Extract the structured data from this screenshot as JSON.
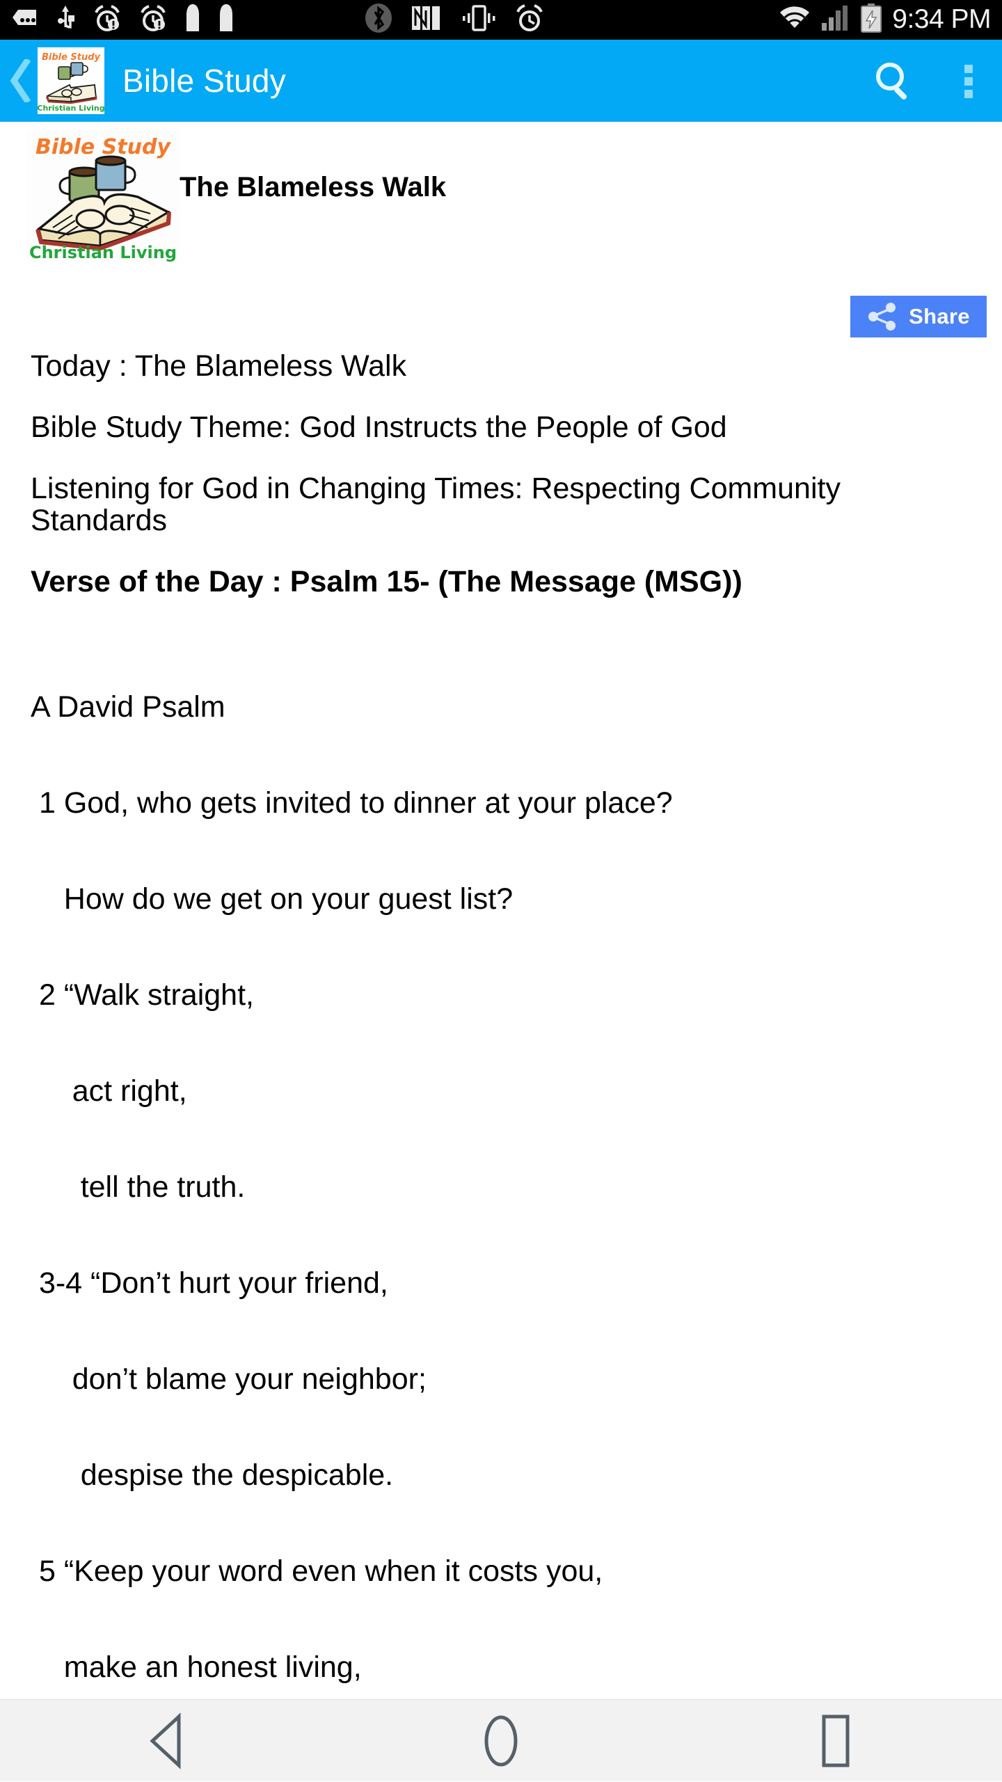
{
  "statusbar": {
    "time": "9:34 PM",
    "icons_left": [
      "sms-icon",
      "usb-icon",
      "alarm-alert-icon",
      "alarm-alert-icon",
      "silent-icon",
      "silent-icon"
    ],
    "icons_mid": [
      "bluetooth-icon",
      "nfc-icon",
      "vibrate-icon",
      "alarm-icon"
    ],
    "icons_right": [
      "wifi-icon",
      "signal-icon",
      "battery-charging-icon"
    ]
  },
  "appbar": {
    "title": "Bible Study",
    "back_label": "Back",
    "search_label": "Search",
    "menu_label": "More options",
    "color": "#03A9F4",
    "logo": {
      "top_text": "Bible Study",
      "bottom_text": "Christian Living"
    }
  },
  "hero": {
    "title": "The Blameless Walk",
    "logo": {
      "top_text": "Bible Study",
      "bottom_text": "Christian Living"
    }
  },
  "share": {
    "label": "Share",
    "color": "#4C82F7"
  },
  "article": {
    "paragraphs": [
      {
        "text": "Today : The Blameless Walk",
        "bold": false
      },
      {
        "text": "Bible Study Theme: God Instructs the People of God",
        "bold": false
      },
      {
        "text": "Listening for God in Changing Times: Respecting Community Standards",
        "bold": false
      },
      {
        "text": "Verse of the Day : Psalm 15- (The Message (MSG))",
        "bold": true
      }
    ],
    "verse_lines": [
      "A David Psalm",
      " 1 God, who gets invited to dinner at your place?",
      "    How do we get on your guest list?",
      " 2 “Walk straight,",
      "     act right,",
      "      tell the truth.",
      " 3-4 “Don’t hurt your friend,",
      "     don’t blame your neighbor;",
      "      despise the despicable.",
      " 5 “Keep your word even when it costs you,",
      "    make an honest living,"
    ]
  },
  "navbar": {
    "back_label": "Back",
    "home_label": "Home",
    "recents_label": "Recents"
  }
}
